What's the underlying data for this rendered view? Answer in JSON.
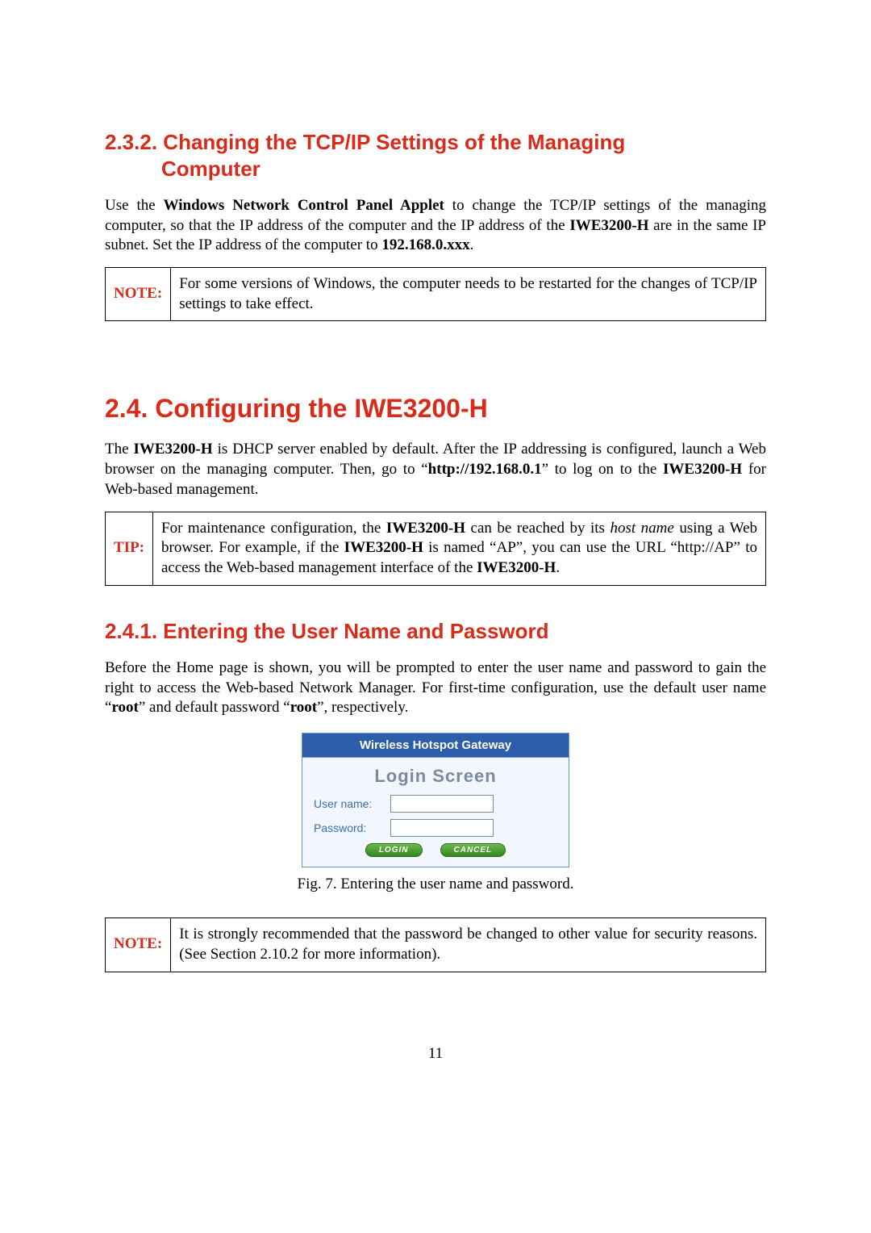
{
  "sections": {
    "s232": {
      "number": "2.3.2.",
      "title_line1": "Changing the TCP/IP Settings of the Managing",
      "title_line2": "Computer",
      "para_pre": "Use the ",
      "applet": "Windows Network Control Panel Applet",
      "para_mid": " to change the TCP/IP settings of the managing computer, so that the IP address of the computer and the IP address of the ",
      "device": "IWE3200-H",
      "para_post": " are in the same IP subnet. Set the IP address of the computer to ",
      "ip_example": "192.168.0.xxx",
      "period": "."
    },
    "note1": {
      "label": "NOTE:",
      "text": "For some versions of Windows, the computer needs to be restarted for the changes of TCP/IP settings to take effect."
    },
    "s24": {
      "number": "2.4.",
      "title": "Configuring the IWE3200-H",
      "p_pre": "The ",
      "device": "IWE3200-H",
      "p_mid1": " is DHCP server enabled by default. After the IP addressing is configured, launch a Web browser on the managing computer. Then, go to “",
      "url": "http://192.168.0.1",
      "p_mid2": "” to log on to the ",
      "p_post": " for Web-based management."
    },
    "tip": {
      "label": "TIP:",
      "pre": "For maintenance configuration, the ",
      "device": "IWE3200-H",
      "mid1": " can be reached by its ",
      "hostname": "host name",
      "mid2": " using a Web browser. For example, if the ",
      "mid3": " is named “AP”, you can use the URL “http://AP” to access the Web-based management interface of the ",
      "end": "."
    },
    "s241": {
      "number": "2.4.1.",
      "title": "Entering the User Name and Password",
      "p_pre": "Before the Home page is shown, you will be prompted to enter the user name and password to gain the right to access the Web-based Network Manager. For first-time configuration, use the default user name “",
      "root1": "root",
      "p_mid": "” and default password “",
      "root2": "root",
      "p_post": "”, respectively."
    },
    "login": {
      "titlebar": "Wireless Hotspot Gateway",
      "heading": "Login  Screen",
      "user_label": "User name:",
      "pass_label": "Password:",
      "login_btn": "LOGIN",
      "cancel_btn": "CANCEL",
      "caption": "Fig. 7. Entering the user name and password."
    },
    "note2": {
      "label": "NOTE:",
      "text": "It is strongly recommended that the password be changed to other value for security reasons. (See Section 2.10.2 for more information)."
    },
    "page_number": "11"
  }
}
